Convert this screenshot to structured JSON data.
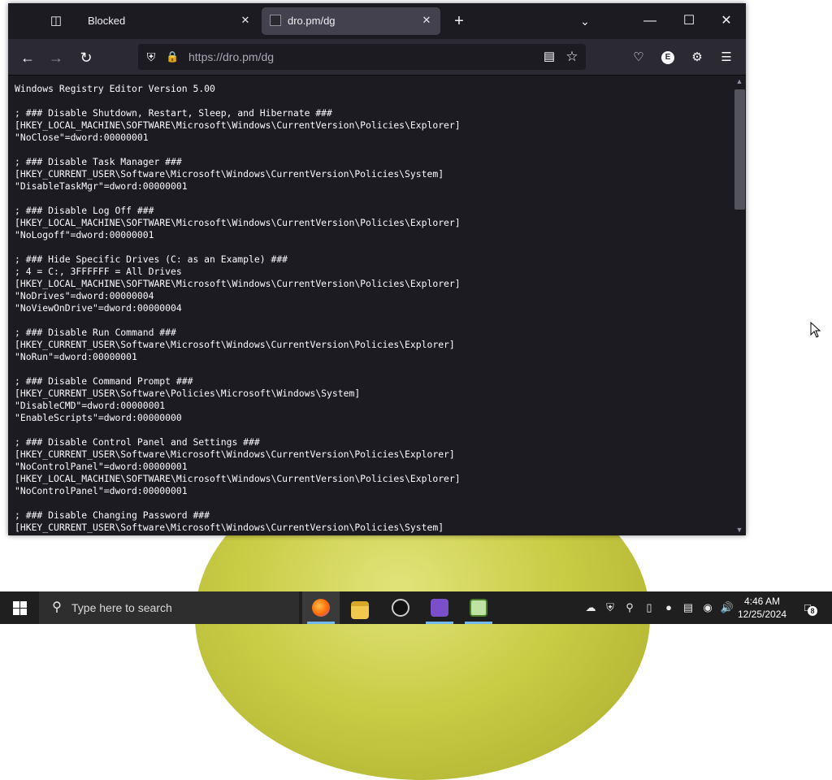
{
  "browser": {
    "tabs": [
      {
        "title": "Blocked",
        "active": false
      },
      {
        "title": "dro.pm/dg",
        "active": true
      }
    ],
    "url": "https://dro.pm/dg",
    "account_initial": "E"
  },
  "page": {
    "lines": [
      "Windows Registry Editor Version 5.00",
      "",
      "; ### Disable Shutdown, Restart, Sleep, and Hibernate ###",
      "[HKEY_LOCAL_MACHINE\\SOFTWARE\\Microsoft\\Windows\\CurrentVersion\\Policies\\Explorer]",
      "\"NoClose\"=dword:00000001",
      "",
      "; ### Disable Task Manager ###",
      "[HKEY_CURRENT_USER\\Software\\Microsoft\\Windows\\CurrentVersion\\Policies\\System]",
      "\"DisableTaskMgr\"=dword:00000001",
      "",
      "; ### Disable Log Off ###",
      "[HKEY_LOCAL_MACHINE\\SOFTWARE\\Microsoft\\Windows\\CurrentVersion\\Policies\\Explorer]",
      "\"NoLogoff\"=dword:00000001",
      "",
      "; ### Hide Specific Drives (C: as an Example) ###",
      "; 4 = C:, 3FFFFFF = All Drives",
      "[HKEY_LOCAL_MACHINE\\SOFTWARE\\Microsoft\\Windows\\CurrentVersion\\Policies\\Explorer]",
      "\"NoDrives\"=dword:00000004",
      "\"NoViewOnDrive\"=dword:00000004",
      "",
      "; ### Disable Run Command ###",
      "[HKEY_CURRENT_USER\\Software\\Microsoft\\Windows\\CurrentVersion\\Policies\\Explorer]",
      "\"NoRun\"=dword:00000001",
      "",
      "; ### Disable Command Prompt ###",
      "[HKEY_CURRENT_USER\\Software\\Policies\\Microsoft\\Windows\\System]",
      "\"DisableCMD\"=dword:00000001",
      "\"EnableScripts\"=dword:00000000",
      "",
      "; ### Disable Control Panel and Settings ###",
      "[HKEY_CURRENT_USER\\Software\\Microsoft\\Windows\\CurrentVersion\\Policies\\Explorer]",
      "\"NoControlPanel\"=dword:00000001",
      "[HKEY_LOCAL_MACHINE\\SOFTWARE\\Microsoft\\Windows\\CurrentVersion\\Policies\\Explorer]",
      "\"NoControlPanel\"=dword:00000001",
      "",
      "; ### Disable Changing Password ###",
      "[HKEY_CURRENT_USER\\Software\\Microsoft\\Windows\\CurrentVersion\\Policies\\System]"
    ]
  },
  "taskbar": {
    "search_placeholder": "Type here to search",
    "apps": [
      "firefox-icon",
      "file-explorer-icon",
      "app-icon",
      "visual-studio-icon",
      "notepad-icon"
    ],
    "time": "4:46 AM",
    "date": "12/25/2024",
    "notification_count": "8"
  },
  "colors": {
    "page_bg": "#1c1b22",
    "toolbar": "#2b2a33",
    "active_tab": "#42414d",
    "taskbar": "#1f1f1f",
    "accent": "#76b9ed"
  }
}
